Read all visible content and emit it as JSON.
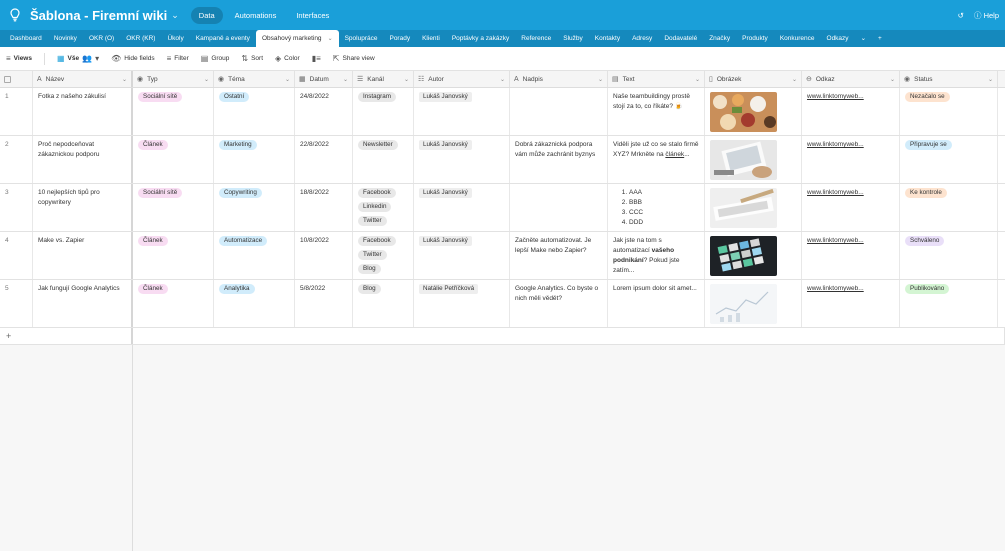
{
  "app": {
    "title": "Šablona - Firemní wiki",
    "nav": [
      "Data",
      "Automations",
      "Interfaces"
    ],
    "nav_active": "Data",
    "help_label": "Help"
  },
  "tabs": [
    "Dashboard",
    "Novinky",
    "OKR (O)",
    "OKR (KR)",
    "Úkoly",
    "Kampaně a eventy",
    "Obsahový marketing",
    "Spolupráce",
    "Porady",
    "Klienti",
    "Poptávky a zakázky",
    "Reference",
    "Služby",
    "Kontakty",
    "Adresy",
    "Dodavatelé",
    "Značky",
    "Produkty",
    "Konkurence",
    "Odkazy"
  ],
  "tab_active": "Obsahový marketing",
  "toolbar": {
    "views": "Views",
    "view_name": "Vše",
    "hide_fields": "Hide fields",
    "filter": "Filter",
    "group": "Group",
    "sort": "Sort",
    "color": "Color",
    "share_view": "Share view"
  },
  "columns": {
    "name": "Název",
    "typ": "Typ",
    "tema": "Téma",
    "datum": "Datum",
    "kanal": "Kanál",
    "autor": "Autor",
    "nadpis": "Nadpis",
    "text": "Text",
    "obrazek": "Obrázek",
    "odkaz": "Odkaz",
    "status": "Status"
  },
  "rows": [
    {
      "num": "1",
      "name": "Fotka z našeho zákulisí",
      "typ": "Sociální sítě",
      "tema": "Ostatní",
      "datum": "24/8/2022",
      "kanal": [
        "Instagram"
      ],
      "autor": "Lukáš Janovský",
      "nadpis": "",
      "text": "Naše teambuildingy prostě stojí za to, co říkáte? 🍺",
      "odkaz": "www.linktomyweb...",
      "status": "Nezačalo se"
    },
    {
      "num": "2",
      "name": "Proč nepodceňovat zákaznickou podporu",
      "typ": "Článek",
      "tema": "Marketing",
      "datum": "22/8/2022",
      "kanal": [
        "Newsletter"
      ],
      "autor": "Lukáš Janovský",
      "nadpis": "Dobrá zákaznická podpora vám může zachránit byznys",
      "text_a": "Viděli jste už co se stalo firmě XYZ? Mrkněte na ",
      "text_b": "článek",
      "text_c": "...",
      "odkaz": "www.linktomyweb...",
      "status": "Připravuje se"
    },
    {
      "num": "3",
      "name": "10 nejlepších tipů pro copywritery",
      "typ": "Sociální sítě",
      "tema": "Copywriting",
      "datum": "18/8/2022",
      "kanal": [
        "Facebook",
        "Linkedin",
        "Twitter"
      ],
      "autor": "Lukáš Janovský",
      "nadpis": "",
      "list": [
        "AAA",
        "BBB",
        "CCC",
        "DDD"
      ],
      "odkaz": "www.linktomyweb...",
      "status": "Ke kontrole"
    },
    {
      "num": "4",
      "name": "Make vs. Zapier",
      "typ": "Článek",
      "tema": "Automatizace",
      "datum": "10/8/2022",
      "kanal": [
        "Facebook",
        "Twitter",
        "Blog"
      ],
      "autor": "Lukáš Janovský",
      "nadpis": "Začněte automatizovat. Je lepší Make nebo Zapier?",
      "text_a": "Jak jste na tom s automatizací ",
      "text_b": "vašeho podnikání",
      "text_c": "? Pokud jste zatím...",
      "odkaz": "www.linktomyweb...",
      "status": "Schváleno"
    },
    {
      "num": "5",
      "name": "Jak fungují Google Analytics",
      "typ": "Článek",
      "tema": "Analytika",
      "datum": "5/8/2022",
      "kanal": [
        "Blog"
      ],
      "autor": "Natálie Petříčková",
      "nadpis": "Google Analytics. Co byste o nich měli vědět?",
      "text": "Lorem ipsum dolor sit amet...",
      "odkaz": "www.linktomyweb...",
      "status": "Publikováno"
    }
  ],
  "add_row": "+"
}
